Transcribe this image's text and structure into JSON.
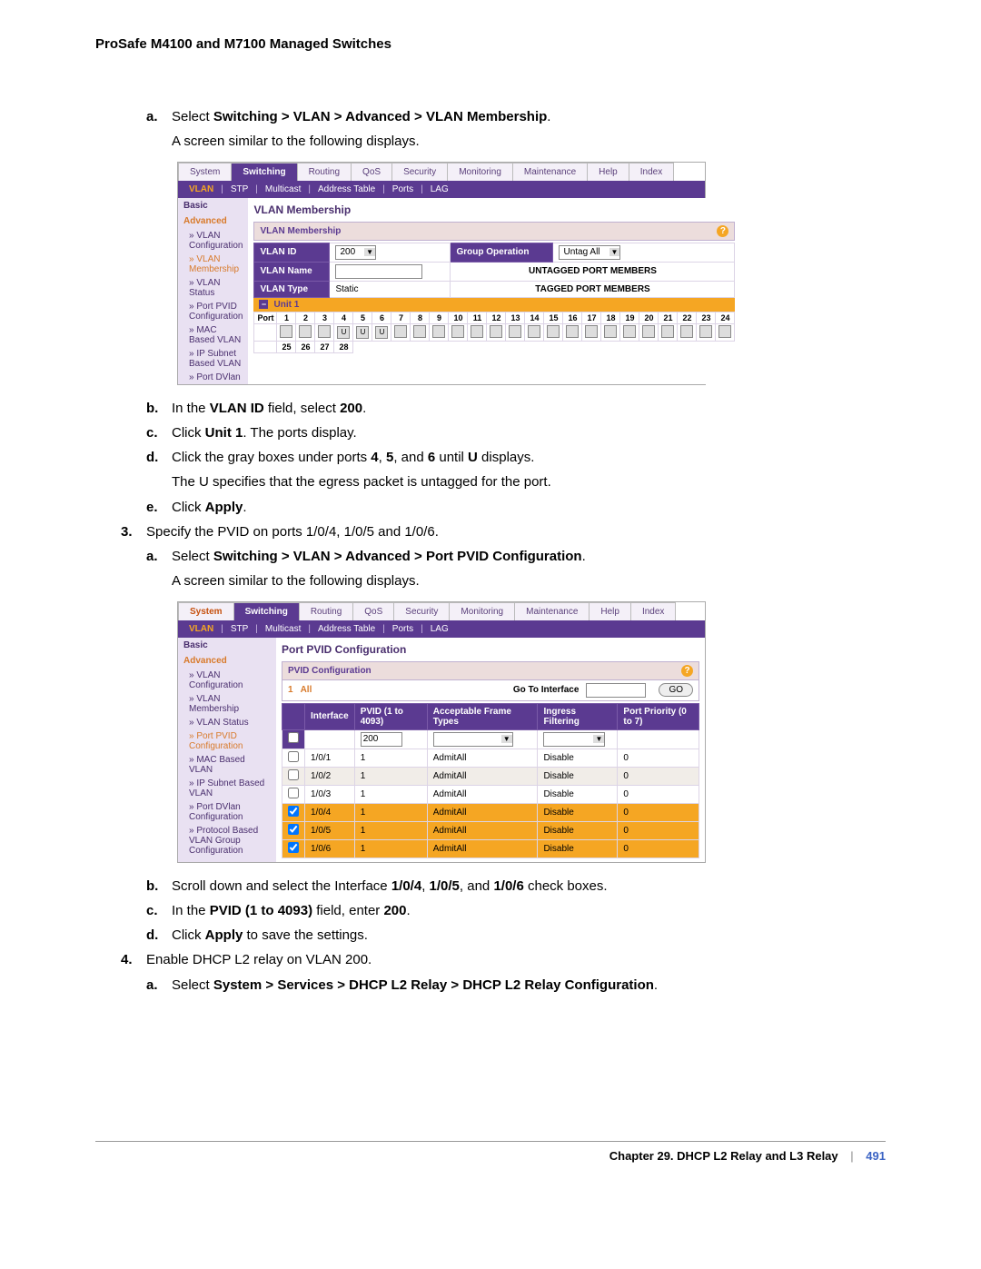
{
  "header": {
    "title": "ProSafe M4100 and M7100 Managed Switches"
  },
  "steps": {
    "a1_prefix": "a.",
    "a1_text1": "Select ",
    "a1_bold": "Switching > VLAN > Advanced > VLAN Membership",
    "a1_text2": ".",
    "a1_follow": "A screen similar to the following displays.",
    "b1_prefix": "b.",
    "b1_t1": "In the ",
    "b1_b1": "VLAN ID",
    "b1_t2": " field, select ",
    "b1_b2": "200",
    "b1_t3": ".",
    "c1_prefix": "c.",
    "c1_t1": "Click ",
    "c1_b1": "Unit 1",
    "c1_t2": ". The ports display.",
    "d1_prefix": "d.",
    "d1_t1": "Click the gray boxes under ports ",
    "d1_b1": "4",
    "d1_t2": ", ",
    "d1_b2": "5",
    "d1_t3": ", and ",
    "d1_b3": "6",
    "d1_t4": " until ",
    "d1_b4": "U",
    "d1_t5": " displays.",
    "d1_follow": "The U specifies that the egress packet is untagged for the port.",
    "e1_prefix": "e.",
    "e1_t1": "Click ",
    "e1_b1": "Apply",
    "e1_t2": ".",
    "n3_prefix": "3.",
    "n3_text": "Specify the PVID on ports 1/0/4, 1/0/5 and 1/0/6.",
    "a2_prefix": "a.",
    "a2_t1": "Select ",
    "a2_b1": "Switching > VLAN > Advanced > Port PVID Configuration",
    "a2_t2": ".",
    "a2_follow": "A screen similar to the following displays.",
    "b2_prefix": "b.",
    "b2_t1": "Scroll down and select the Interface ",
    "b2_b1": "1/0/4",
    "b2_t2": ", ",
    "b2_b2": "1/0/5",
    "b2_t3": ", and ",
    "b2_b3": "1/0/6",
    "b2_t4": " check boxes.",
    "c2_prefix": "c.",
    "c2_t1": "In the ",
    "c2_b1": "PVID (1 to 4093)",
    "c2_t2": " field, enter ",
    "c2_b2": "200",
    "c2_t3": ".",
    "d2_prefix": "d.",
    "d2_t1": "Click ",
    "d2_b1": "Apply",
    "d2_t2": " to save the settings.",
    "n4_prefix": "4.",
    "n4_text": "Enable DHCP L2 relay on VLAN 200.",
    "a3_prefix": "a.",
    "a3_t1": "Select ",
    "a3_b1": "System > Services > DHCP L2 Relay > DHCP L2 Relay Configuration",
    "a3_t2": "."
  },
  "shot1": {
    "tabs": [
      "System",
      "Switching",
      "Routing",
      "QoS",
      "Security",
      "Monitoring",
      "Maintenance",
      "Help",
      "Index"
    ],
    "active_tab": "Switching",
    "subnav": [
      "VLAN",
      "STP",
      "Multicast",
      "Address Table",
      "Ports",
      "LAG"
    ],
    "active_sub": "VLAN",
    "sidebar_basic": "Basic",
    "sidebar_advanced": "Advanced",
    "sidebar_items": [
      "VLAN Configuration",
      "VLAN Membership",
      "VLAN Status",
      "Port PVID Configuration",
      "MAC Based VLAN",
      "IP Subnet Based VLAN",
      "Port DVlan"
    ],
    "sidebar_active": "VLAN Membership",
    "panel_title": "VLAN Membership",
    "section_title": "VLAN Membership",
    "row_vlan_id_lbl": "VLAN ID",
    "row_vlan_id_val": "200",
    "group_op_lbl": "Group Operation",
    "group_op_val": "Untag All",
    "row_vlan_name_lbl": "VLAN Name",
    "row_vlan_name_val": "",
    "untagged_band": "UNTAGGED PORT MEMBERS",
    "row_vlan_type_lbl": "VLAN Type",
    "row_vlan_type_val": "Static",
    "tagged_band": "TAGGED PORT MEMBERS",
    "unit_label": "Unit 1",
    "ports_r1": [
      "Port",
      "1",
      "2",
      "3",
      "4",
      "5",
      "6",
      "7",
      "8",
      "9",
      "10",
      "11",
      "12",
      "13",
      "14",
      "15",
      "16",
      "17",
      "18",
      "19",
      "20",
      "21",
      "22",
      "23",
      "24"
    ],
    "ports_r1_u": {
      "4": "U",
      "5": "U",
      "6": "U"
    },
    "ports_r2": [
      "",
      "25",
      "26",
      "27",
      "28"
    ]
  },
  "shot2": {
    "tabs": [
      "System",
      "Switching",
      "Routing",
      "QoS",
      "Security",
      "Monitoring",
      "Maintenance",
      "Help",
      "Index"
    ],
    "active_tab": "Switching",
    "system_orange": true,
    "subnav": [
      "VLAN",
      "STP",
      "Multicast",
      "Address Table",
      "Ports",
      "LAG"
    ],
    "active_sub": "VLAN",
    "sidebar_basic": "Basic",
    "sidebar_advanced": "Advanced",
    "sidebar_items": [
      "VLAN Configuration",
      "VLAN Membership",
      "VLAN Status",
      "Port PVID Configuration",
      "MAC Based VLAN",
      "IP Subnet Based VLAN",
      "Port DVlan Configuration",
      "Protocol Based VLAN Group Configuration"
    ],
    "sidebar_active": "Port PVID Configuration",
    "panel_title": "Port PVID Configuration",
    "section_title": "PVID Configuration",
    "filter_num": "1",
    "filter_all": "All",
    "goto_lbl": "Go To Interface",
    "go_btn": "GO",
    "thead": [
      "",
      "Interface",
      "PVID (1 to 4093)",
      "Acceptable Frame Types",
      "Ingress Filtering",
      "Port Priority (0 to 7)"
    ],
    "input_row_pvid": "200",
    "rows": [
      {
        "chk": false,
        "hl": false,
        "if": "1/0/1",
        "pvid": "1",
        "aft": "AdmitAll",
        "ing": "Disable",
        "pp": "0"
      },
      {
        "chk": false,
        "hl": false,
        "lite": true,
        "if": "1/0/2",
        "pvid": "1",
        "aft": "AdmitAll",
        "ing": "Disable",
        "pp": "0"
      },
      {
        "chk": false,
        "hl": false,
        "if": "1/0/3",
        "pvid": "1",
        "aft": "AdmitAll",
        "ing": "Disable",
        "pp": "0"
      },
      {
        "chk": true,
        "hl": true,
        "if": "1/0/4",
        "pvid": "1",
        "aft": "AdmitAll",
        "ing": "Disable",
        "pp": "0"
      },
      {
        "chk": true,
        "hl": true,
        "if": "1/0/5",
        "pvid": "1",
        "aft": "AdmitAll",
        "ing": "Disable",
        "pp": "0"
      },
      {
        "chk": true,
        "hl": true,
        "if": "1/0/6",
        "pvid": "1",
        "aft": "AdmitAll",
        "ing": "Disable",
        "pp": "0"
      }
    ]
  },
  "footer": {
    "chapter": "Chapter 29.  DHCP L2 Relay and L3 Relay",
    "page": "491"
  }
}
